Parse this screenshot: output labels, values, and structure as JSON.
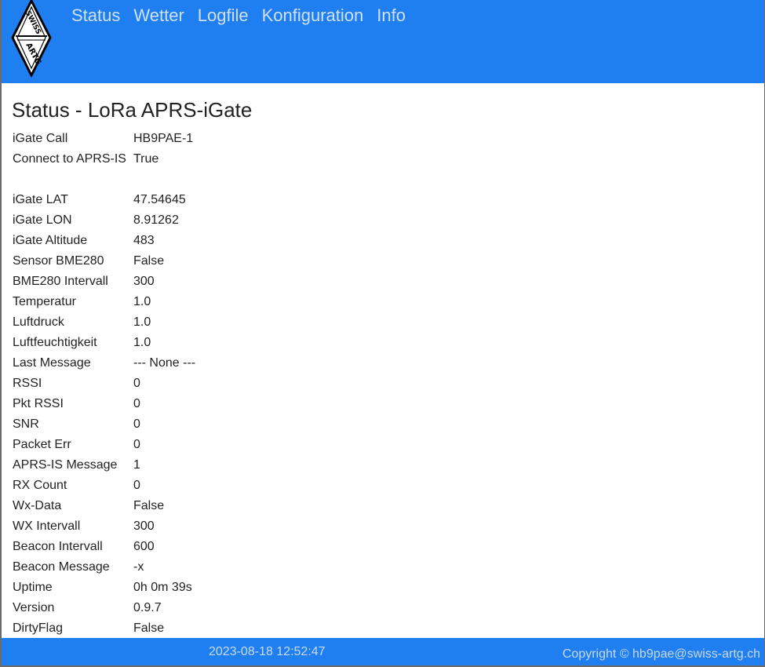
{
  "nav": {
    "items": [
      {
        "label": "Status"
      },
      {
        "label": "Wetter"
      },
      {
        "label": "Logfile"
      },
      {
        "label": "Konfiguration"
      },
      {
        "label": "Info"
      }
    ]
  },
  "logo": {
    "icon": "swiss-artg-diamond-logo",
    "text": "SWISS ARTG"
  },
  "page": {
    "title": "Status - LoRa APRS-iGate"
  },
  "status": {
    "rows": [
      {
        "label": "iGate Call",
        "value": "HB9PAE-1"
      },
      {
        "label": "Connect to APRS-IS",
        "value": "True"
      },
      {
        "label": "iGate LAT",
        "value": "47.54645"
      },
      {
        "label": "iGate LON",
        "value": "8.91262"
      },
      {
        "label": "iGate Altitude",
        "value": "483"
      },
      {
        "label": "Sensor BME280",
        "value": "False"
      },
      {
        "label": "BME280 Intervall",
        "value": "300"
      },
      {
        "label": "Temperatur",
        "value": "1.0"
      },
      {
        "label": "Luftdruck",
        "value": "1.0"
      },
      {
        "label": "Luftfeuchtigkeit",
        "value": "1.0"
      },
      {
        "label": "Last Message",
        "value": "--- None ---"
      },
      {
        "label": "RSSI",
        "value": "0"
      },
      {
        "label": "Pkt RSSI",
        "value": "0"
      },
      {
        "label": "SNR",
        "value": "0"
      },
      {
        "label": "Packet Err",
        "value": "0"
      },
      {
        "label": "APRS-IS Message",
        "value": "1"
      },
      {
        "label": "RX Count",
        "value": "0"
      },
      {
        "label": "Wx-Data",
        "value": "False"
      },
      {
        "label": "WX Intervall",
        "value": "300"
      },
      {
        "label": "Beacon Intervall",
        "value": "600"
      },
      {
        "label": "Beacon Message",
        "value": "-x"
      },
      {
        "label": "Uptime",
        "value": "0h 0m 39s"
      },
      {
        "label": "Version",
        "value": "0.9.7"
      },
      {
        "label": "DirtyFlag",
        "value": "False"
      }
    ]
  },
  "footer": {
    "datetime": "2023-08-18 12:52:47",
    "copyright": "Copyright © hb9pae@swiss-artg.ch"
  },
  "colors": {
    "header_bg": "#1f7ef0",
    "nav_text": "#cfe0f6",
    "footer_text": "#c9d9ee"
  }
}
